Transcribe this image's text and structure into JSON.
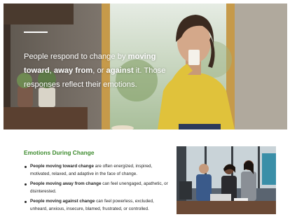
{
  "hero": {
    "text_part1": "People respond to change by ",
    "text_bold1": "moving toward",
    "text_part2": ", ",
    "text_bold2": "away from",
    "text_part3": ", or ",
    "text_bold3": "against",
    "text_part4": " it. Those responses reflect their emotions."
  },
  "section": {
    "title": "Emotions During Change",
    "bullets": [
      {
        "bold": "People moving toward change",
        "text": " are often energized, inspired, motivated, relaxed, and adaptive in the face of change."
      },
      {
        "bold": "People moving away from change",
        "text": " can feel unengaged, apathetic, or disinterested."
      },
      {
        "bold": "People moving against change",
        "text": " can feel powerless, excluded, unheard, anxious, insecure, blamed, frustrated, or controlled."
      }
    ]
  },
  "colors": {
    "title_green": "#3d8b2e",
    "text_dark": "#222222",
    "hero_text": "#ffffff"
  }
}
